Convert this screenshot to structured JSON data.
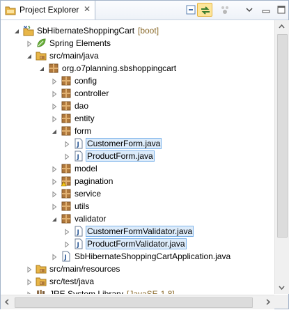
{
  "tab": {
    "title": "Project Explorer",
    "close": "✕"
  },
  "toolbar": [
    {
      "name": "collapse-all-button",
      "icon": "collapse-all-icon",
      "active": false
    },
    {
      "name": "link-with-editor-button",
      "icon": "link-icon",
      "active": true
    },
    {
      "name": "focus-task-button",
      "icon": "focus-icon",
      "active": false
    },
    {
      "name": "view-menu-button",
      "icon": "chevron-down-icon",
      "active": false
    },
    {
      "name": "minimize-button",
      "icon": "minimize-icon",
      "active": false
    },
    {
      "name": "maximize-button",
      "icon": "maximize-icon",
      "active": false
    }
  ],
  "tree": [
    {
      "depth": 0,
      "expanded": true,
      "icon": "project",
      "label": "SbHibernateShoppingCart",
      "decoration": "[boot]"
    },
    {
      "depth": 1,
      "expanded": false,
      "icon": "spring",
      "label": "Spring Elements"
    },
    {
      "depth": 1,
      "expanded": true,
      "icon": "srcfolder",
      "label": "src/main/java"
    },
    {
      "depth": 2,
      "expanded": true,
      "icon": "package",
      "label": "org.o7planning.sbshoppingcart"
    },
    {
      "depth": 3,
      "expanded": false,
      "icon": "package",
      "label": "config"
    },
    {
      "depth": 3,
      "expanded": false,
      "icon": "package",
      "label": "controller"
    },
    {
      "depth": 3,
      "expanded": false,
      "icon": "package",
      "label": "dao"
    },
    {
      "depth": 3,
      "expanded": false,
      "icon": "package",
      "label": "entity"
    },
    {
      "depth": 3,
      "expanded": true,
      "icon": "package",
      "label": "form"
    },
    {
      "depth": 4,
      "expanded": false,
      "icon": "java",
      "label": "CustomerForm.java",
      "selected": true
    },
    {
      "depth": 4,
      "expanded": false,
      "icon": "java",
      "label": "ProductForm.java",
      "selected": true
    },
    {
      "depth": 3,
      "expanded": false,
      "icon": "package",
      "label": "model"
    },
    {
      "depth": 3,
      "expanded": false,
      "icon": "package-warn",
      "label": "pagination"
    },
    {
      "depth": 3,
      "expanded": false,
      "icon": "package",
      "label": "service"
    },
    {
      "depth": 3,
      "expanded": false,
      "icon": "package",
      "label": "utils"
    },
    {
      "depth": 3,
      "expanded": true,
      "icon": "package",
      "label": "validator"
    },
    {
      "depth": 4,
      "expanded": false,
      "icon": "java",
      "label": "CustomerFormValidator.java",
      "selected": true
    },
    {
      "depth": 4,
      "expanded": false,
      "icon": "java",
      "label": "ProductFormValidator.java",
      "selected": true
    },
    {
      "depth": 3,
      "expanded": false,
      "icon": "java",
      "label": "SbHibernateShoppingCartApplication.java"
    },
    {
      "depth": 1,
      "expanded": false,
      "icon": "srcfolder",
      "label": "src/main/resources"
    },
    {
      "depth": 1,
      "expanded": false,
      "icon": "srcfolder",
      "label": "src/test/java"
    },
    {
      "depth": 1,
      "expanded": false,
      "icon": "library",
      "label": "JRE System Library",
      "decoration": "[JavaSE-1.8]"
    }
  ]
}
